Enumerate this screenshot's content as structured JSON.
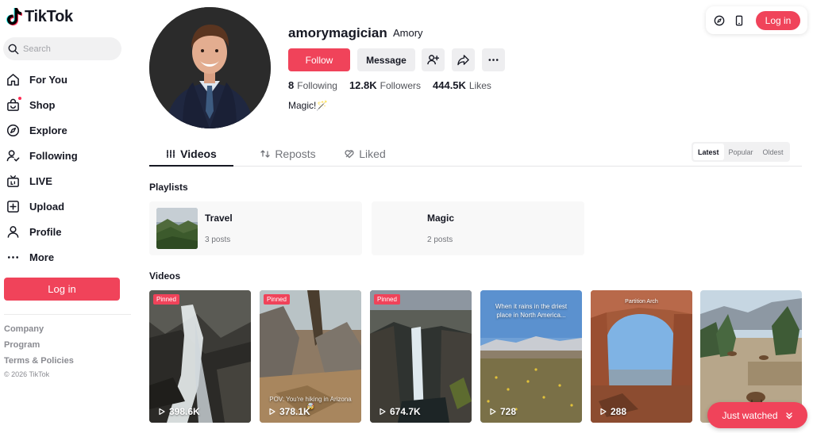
{
  "app": {
    "name": "TikTok",
    "brand_color": "#fe2c55",
    "button_color": "#f0435a"
  },
  "search": {
    "placeholder": "Search"
  },
  "sidebar": {
    "items": [
      {
        "label": "For You",
        "icon": "home-icon"
      },
      {
        "label": "Shop",
        "icon": "shop-icon"
      },
      {
        "label": "Explore",
        "icon": "compass-icon"
      },
      {
        "label": "Following",
        "icon": "following-icon"
      },
      {
        "label": "LIVE",
        "icon": "live-icon"
      },
      {
        "label": "Upload",
        "icon": "upload-icon"
      },
      {
        "label": "Profile",
        "icon": "profile-icon"
      },
      {
        "label": "More",
        "icon": "more-icon"
      }
    ],
    "login_label": "Log in",
    "footer_links": [
      "Company",
      "Program",
      "Terms & Policies"
    ],
    "copyright": "© 2026 TikTok"
  },
  "topbar": {
    "login_label": "Log in",
    "icons": [
      "coin-icon",
      "device-icon"
    ]
  },
  "profile": {
    "username": "amorymagician",
    "nickname": "Amory",
    "follow_label": "Follow",
    "message_label": "Message",
    "stats": {
      "following_count": "8",
      "following_label": "Following",
      "followers_count": "12.8K",
      "followers_label": "Followers",
      "likes_count": "444.5K",
      "likes_label": "Likes"
    },
    "bio": "Magic!🪄"
  },
  "tabs": [
    "Videos",
    "Reposts",
    "Liked"
  ],
  "active_tab": "Videos",
  "sort_options": [
    "Latest",
    "Popular",
    "Oldest"
  ],
  "active_sort": "Latest",
  "playlists": {
    "title": "Playlists",
    "items": [
      {
        "name": "Travel",
        "count": "3 posts"
      },
      {
        "name": "Magic",
        "count": "2 posts"
      }
    ]
  },
  "videos": {
    "title": "Videos",
    "items": [
      {
        "views": "398.6K",
        "pinned_label": "Pinned"
      },
      {
        "views": "378.1K",
        "pinned_label": "Pinned",
        "caption": "POV: You're hiking in Arizona 🤯"
      },
      {
        "views": "674.7K",
        "pinned_label": "Pinned"
      },
      {
        "views": "728",
        "caption": "When it rains in the driest place in North America..."
      },
      {
        "views": "288",
        "caption": "Partition Arch"
      },
      {
        "views": ""
      }
    ]
  },
  "just_watched_label": "Just watched"
}
